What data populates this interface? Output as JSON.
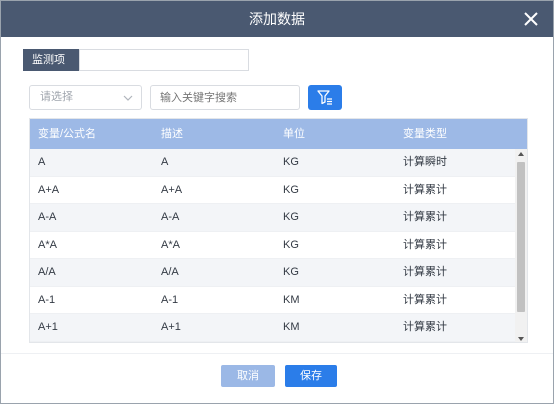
{
  "dialog": {
    "title": "添加数据",
    "close_icon": "close-icon"
  },
  "monitor": {
    "label": "监测项",
    "value": ""
  },
  "filter": {
    "select_placeholder": "请选择",
    "keyword_placeholder": "输入关键字搜索",
    "filter_icon": "filter-icon"
  },
  "table": {
    "headers": [
      "变量/公式名",
      "描述",
      "单位",
      "变量类型"
    ],
    "rows": [
      [
        "A",
        "A",
        "KG",
        "计算瞬时"
      ],
      [
        "A+A",
        "A+A",
        "KG",
        "计算累计"
      ],
      [
        "A-A",
        "A-A",
        "KG",
        "计算累计"
      ],
      [
        "A*A",
        "A*A",
        "KG",
        "计算累计"
      ],
      [
        "A/A",
        "A/A",
        "KG",
        "计算累计"
      ],
      [
        "A-1",
        "A-1",
        "KM",
        "计算累计"
      ],
      [
        "A+1",
        "A+1",
        "KM",
        "计算累计"
      ]
    ]
  },
  "buttons": {
    "cancel": "取消",
    "save": "保存"
  },
  "colors": {
    "titlebar": "#4a5971",
    "header": "#9db9e6",
    "primary": "#2b7de9",
    "cancel": "#9bb8e6"
  }
}
